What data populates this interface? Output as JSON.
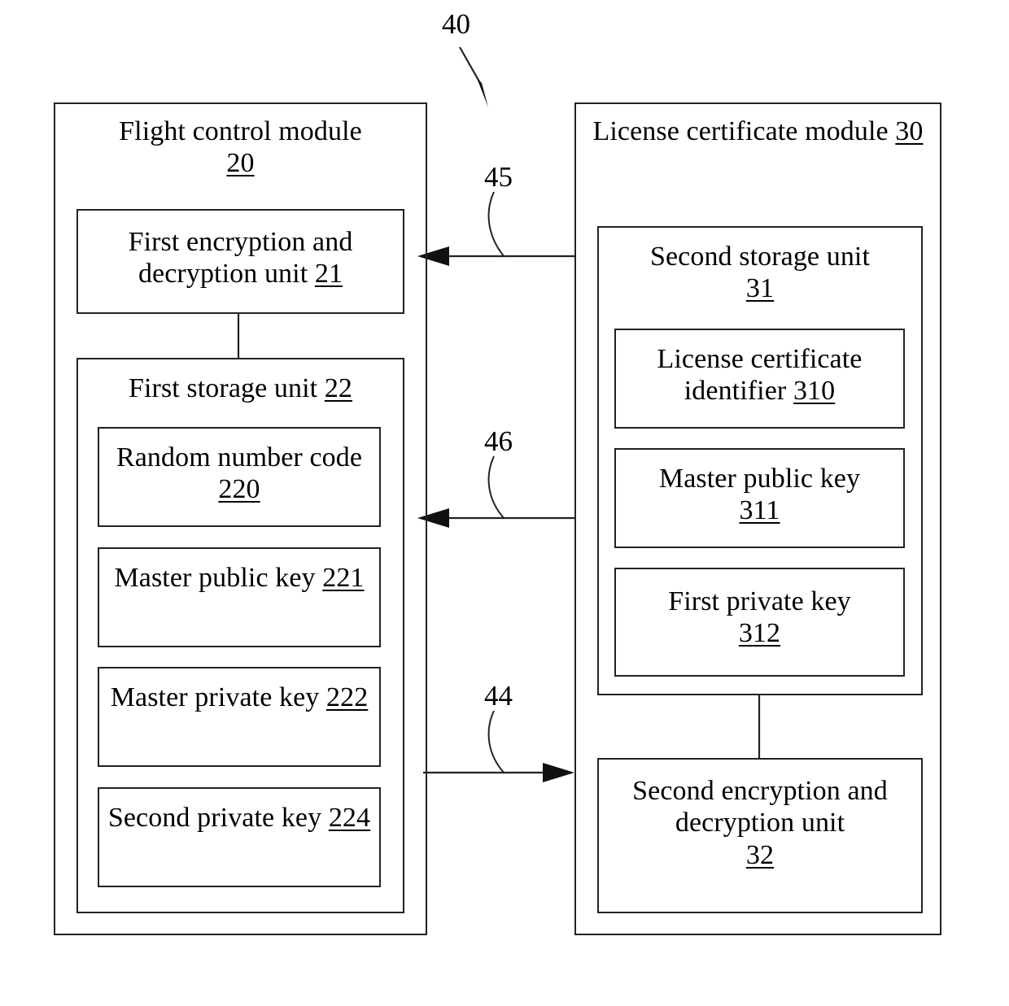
{
  "figure": {
    "reference_numeral": "40",
    "left_module": {
      "title_text": "Flight control module",
      "title_num": "20",
      "encryption_unit": {
        "text": "First encryption and decryption unit ",
        "num": "21"
      },
      "storage_unit": {
        "text": "First storage unit ",
        "num": "22",
        "items": [
          {
            "text": "Random number code ",
            "num": "220"
          },
          {
            "text": "Master public key ",
            "num": "221"
          },
          {
            "text": "Master private key ",
            "num": "222"
          },
          {
            "text": "Second private key ",
            "num": "224"
          }
        ]
      }
    },
    "right_module": {
      "title_text": "License certificate module ",
      "title_num": "30",
      "storage_unit": {
        "text": "Second storage unit ",
        "num": "31",
        "items": [
          {
            "text": "License certificate identifier ",
            "num": "310"
          },
          {
            "text": "Master public key ",
            "num": "311"
          },
          {
            "text": "First private key ",
            "num": "312"
          }
        ]
      },
      "encryption_unit": {
        "text": "Second encryption and decryption unit ",
        "num": "32"
      }
    },
    "connectors": [
      {
        "label": "45",
        "direction": "right-to-left"
      },
      {
        "label": "46",
        "direction": "right-to-left"
      },
      {
        "label": "44",
        "direction": "left-to-right"
      }
    ],
    "colors": {
      "stroke": "#222222",
      "background": "#ffffff",
      "text": "#000000"
    }
  }
}
